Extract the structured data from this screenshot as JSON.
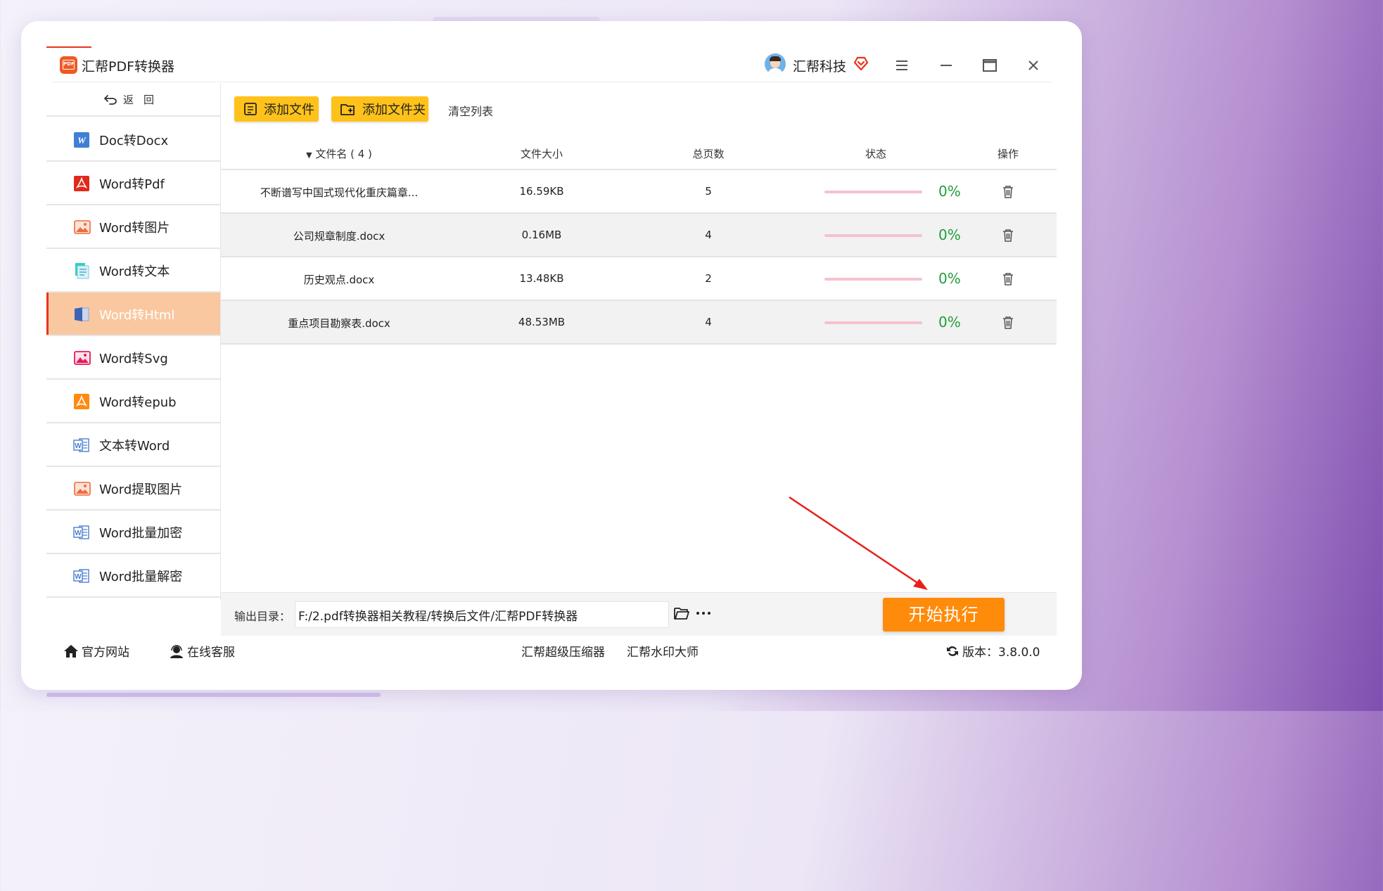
{
  "app": {
    "title": "汇帮PDF转换器",
    "logo_text": "PDF",
    "user_name": "汇帮科技",
    "icons": [
      "vip-heart-icon",
      "hamburger-menu-icon",
      "minimize-icon",
      "maximize-icon",
      "close-icon"
    ],
    "accent_color": "#ef5a23"
  },
  "sidebar": {
    "back_label": "返回",
    "items": [
      {
        "label": "Doc转Docx",
        "icon": "word-doc-icon"
      },
      {
        "label": "Word转Pdf",
        "icon": "pdf-icon"
      },
      {
        "label": "Word转图片",
        "icon": "image-icon"
      },
      {
        "label": "Word转文本",
        "icon": "text-doc-icon"
      },
      {
        "label": "Word转Html",
        "icon": "html-doc-icon",
        "active": true
      },
      {
        "label": "Word转Svg",
        "icon": "svg-image-icon"
      },
      {
        "label": "Word转epub",
        "icon": "epub-icon"
      },
      {
        "label": "文本转Word",
        "icon": "word-outline-icon"
      },
      {
        "label": "Word提取图片",
        "icon": "image-icon"
      },
      {
        "label": "Word批量加密",
        "icon": "word-outline-icon"
      },
      {
        "label": "Word批量解密",
        "icon": "word-outline-icon"
      }
    ]
  },
  "toolbar": {
    "add_file": "添加文件",
    "add_folder": "添加文件夹",
    "clear_list": "清空列表"
  },
  "table": {
    "headers": {
      "name": "文件名 ( 4 )",
      "size": "文件大小",
      "pages": "总页数",
      "status": "状态",
      "op": "操作"
    },
    "rows": [
      {
        "name": "不断谱写中国式现代化重庆篇章...",
        "size": "16.59KB",
        "pages": "5",
        "progress": 0,
        "status": "0%"
      },
      {
        "name": "公司规章制度.docx",
        "size": "0.16MB",
        "pages": "4",
        "progress": 0,
        "status": "0%"
      },
      {
        "name": "历史观点.docx",
        "size": "13.48KB",
        "pages": "2",
        "progress": 0,
        "status": "0%"
      },
      {
        "name": "重点项目勘察表.docx",
        "size": "48.53MB",
        "pages": "4",
        "progress": 0,
        "status": "0%"
      }
    ]
  },
  "output": {
    "label": "输出目录：",
    "path": "F:/2.pdf转换器相关教程/转换后文件/汇帮PDF转换器",
    "start_label": "开始执行",
    "start_color": "#ff8b0a"
  },
  "bottom": {
    "official_site": "官方网站",
    "online_service": "在线客服",
    "compressor": "汇帮超级压缩器",
    "watermark": "汇帮水印大师",
    "version": "版本：3.8.0.0"
  }
}
